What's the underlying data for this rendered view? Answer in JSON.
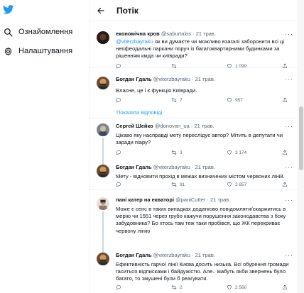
{
  "sidebar": {
    "logo": "twitter-bird-icon",
    "items": [
      {
        "label": "Ознайомлення",
        "icon": "hashtag-icon"
      },
      {
        "label": "Налаштування",
        "icon": "gear-icon"
      }
    ]
  },
  "header": {
    "title": "Потік",
    "back_icon": "arrow-left-icon"
  },
  "show_replies": "Показати відповіді",
  "tweets": [
    {
      "name": "економічна кров",
      "handle": "@saburtalos",
      "date": "· 21 трав.",
      "mention": "@viterzbayraku",
      "text": " як ви думаєте чи можливо взагалі заборонити всі ці неофеодальні паркани поруч із багатоквартирними будинками за рішенням кмда чи київради?",
      "replies": "",
      "retweets": "",
      "likes": "1 099",
      "share": ""
    },
    {
      "name": "Богдан Гдаль",
      "handle": "@viterzbayraku",
      "date": "· 21 трав.",
      "text": "Власне, це і є функція Київради.",
      "replies": "",
      "retweets": "7",
      "likes": "957",
      "share": ""
    },
    {
      "name": "Сергей Шейко",
      "handle": "@donovan_ua",
      "date": "· 21 трав.",
      "text": "Цікаво яку насправді мету переслідує автор? Мітить в депутати чи заради піару?",
      "replies": "",
      "retweets": "3",
      "likes": "3 174",
      "share": ""
    },
    {
      "name": "Богдан Гдаль",
      "handle": "@viterzbayraku",
      "date": "· 21 трав.",
      "text": "Мету - відновити прохід в межах визначених містом червоних ліній.",
      "replies": "",
      "retweets": "91",
      "likes": "2 857",
      "share": ""
    },
    {
      "name": "пані катер на екваторі",
      "handle": "@paniCutter",
      "date": "· 21 трав.",
      "text": "Може є сенс в таких випадках додатково повідомляти/скаржитись в мерію чи 1551 через грубо кажучи порушення законодавства з боку забудовника? Бо хтось там теж таки пробівся, що ЖК перекриває червону лінію",
      "replies": "",
      "retweets": "",
      "likes": "",
      "share": ""
    },
    {
      "name": "Богдан Гдаль",
      "handle": "@viterzbayraku",
      "date": "· 21 трав.",
      "text": "Ефективність гарчої лінії Києва досить низька. Всі обурення громади гаситься відписками і байдужістю. Але.. мабуть якби звернень було багато, то змушені були б реагувати.",
      "replies": "",
      "retweets": "2",
      "likes": "2 560",
      "share": ""
    }
  ],
  "colors": {
    "accent": "#1d9bf0",
    "text": "#0f1419",
    "secondary": "#536471",
    "border": "#eff3f4"
  }
}
